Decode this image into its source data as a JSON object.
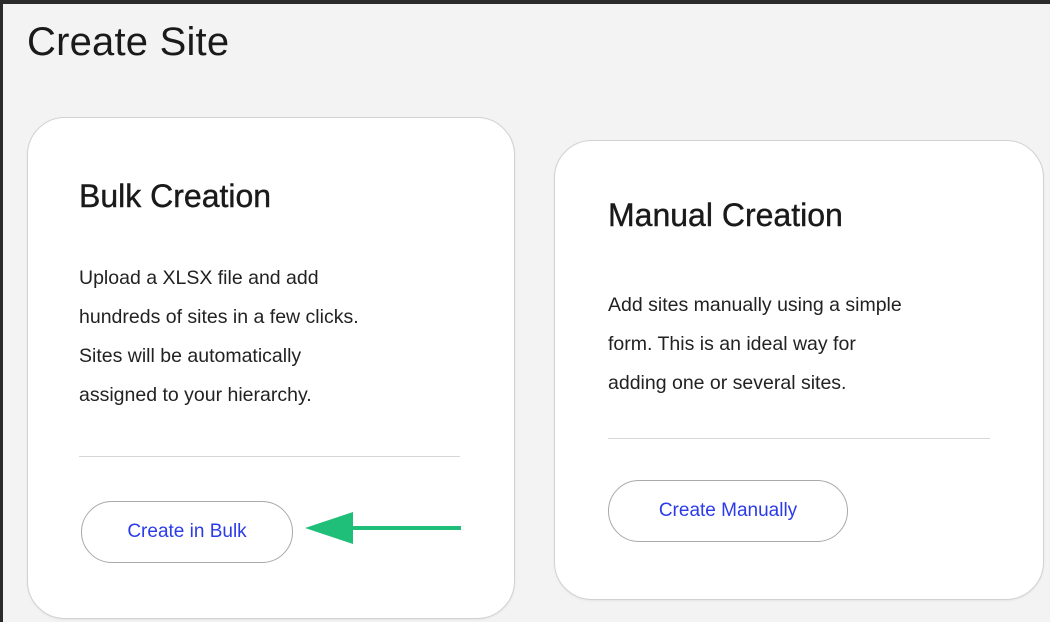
{
  "page": {
    "title": "Create Site"
  },
  "cards": {
    "bulk": {
      "title": "Bulk Creation",
      "description_lines": [
        "Upload a XLSX file and add",
        "hundreds of sites in a few clicks.",
        "Sites will be automatically",
        "assigned to your hierarchy."
      ],
      "button_label": "Create in Bulk"
    },
    "manual": {
      "title": "Manual Creation",
      "description_lines": [
        "Add sites manually using a simple",
        "form. This is an ideal way for",
        "adding one or several sites."
      ],
      "button_label": "Create Manually"
    }
  },
  "annotation": {
    "icon": "arrow-left-icon",
    "color": "#1fbf7a"
  },
  "colors": {
    "button_text": "#2b3be8",
    "background": "#f3f3f3",
    "card": "#ffffff"
  }
}
